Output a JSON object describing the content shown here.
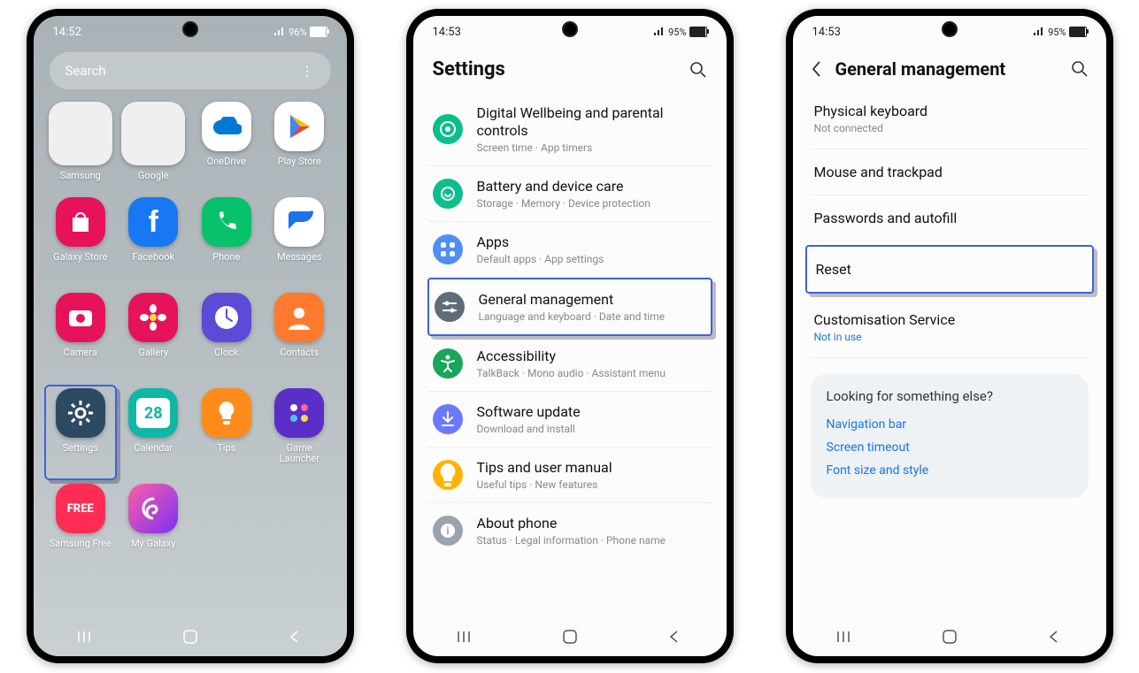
{
  "phone1": {
    "time": "14:52",
    "battery_text": "96%",
    "battery_level": 96,
    "search_placeholder": "Search",
    "apps": [
      {
        "label": "Samsung",
        "type": "folder",
        "colors": [
          "#0b62d6",
          "#00a3e0",
          "#ff9800",
          "#fff"
        ]
      },
      {
        "label": "Google",
        "type": "folder",
        "colors": [
          "#ea4335",
          "#4285f4",
          "#fbbc05",
          "#34a853"
        ]
      },
      {
        "label": "OneDrive",
        "bg": "#ffffff",
        "fg": "#0078d4",
        "glyph": "cloud"
      },
      {
        "label": "Play Store",
        "bg": "#ffffff",
        "fg": "#34a853",
        "glyph": "play"
      },
      {
        "label": "Galaxy Store",
        "bg": "#e6135a",
        "glyph": "bag"
      },
      {
        "label": "Facebook",
        "bg": "#1877f2",
        "glyph": "f"
      },
      {
        "label": "Phone",
        "bg": "#08c26b",
        "glyph": "phone"
      },
      {
        "label": "Messages",
        "bg": "#ffffff",
        "fg": "#1a73e8",
        "glyph": "chat"
      },
      {
        "label": "Camera",
        "bg": "#e6135a",
        "glyph": "camera"
      },
      {
        "label": "Gallery",
        "bg": "#e6135a",
        "glyph": "flower"
      },
      {
        "label": "Clock",
        "bg": "#5b4bd6",
        "glyph": "clock"
      },
      {
        "label": "Contacts",
        "bg": "#ff7a2f",
        "glyph": "person"
      },
      {
        "label": "Settings",
        "bg": "#2d4a63",
        "glyph": "gear",
        "highlight": true
      },
      {
        "label": "Calendar",
        "bg": "#0fb7a7",
        "glyph": "28"
      },
      {
        "label": "Tips",
        "bg": "#ff8c1a",
        "glyph": "bulb"
      },
      {
        "label": "Game Launcher",
        "bg": "#5b2ec7",
        "glyph": "dots4"
      },
      {
        "label": "Samsung Free",
        "bg": "#ff2d55",
        "glyph": "FREE"
      },
      {
        "label": "My Galaxy",
        "bg": "linear-gradient(135deg,#ff5fa2,#7b2ff7)",
        "glyph": "swirl"
      }
    ]
  },
  "phone2": {
    "time": "14:53",
    "battery_text": "95%",
    "title": "Settings",
    "rows": [
      {
        "title": "Digital Wellbeing and parental controls",
        "sub": "Screen time  ·  App timers",
        "color": "#0abf8c",
        "glyph": "target"
      },
      {
        "title": "Battery and device care",
        "sub": "Storage  ·  Memory  ·  Device protection",
        "color": "#0abf8c",
        "glyph": "care"
      },
      {
        "title": "Apps",
        "sub": "Default apps  ·  App settings",
        "color": "#4f8ef7",
        "glyph": "grid4"
      },
      {
        "title": "General management",
        "sub": "Language and keyboard  ·  Date and time",
        "color": "#5f6c7b",
        "glyph": "sliders",
        "highlight": true
      },
      {
        "title": "Accessibility",
        "sub": "TalkBack  ·  Mono audio  ·  Assistant menu",
        "color": "#17a65a",
        "glyph": "a11y"
      },
      {
        "title": "Software update",
        "sub": "Download and install",
        "color": "#6b79ff",
        "glyph": "download"
      },
      {
        "title": "Tips and user manual",
        "sub": "Useful tips  ·  New features",
        "color": "#ffb300",
        "glyph": "bulb"
      },
      {
        "title": "About phone",
        "sub": "Status  ·  Legal information  ·  Phone name",
        "color": "#9aa4ae",
        "glyph": "info"
      }
    ]
  },
  "phone3": {
    "time": "14:53",
    "battery_text": "95%",
    "title": "General management",
    "rows": [
      {
        "title": "Physical keyboard",
        "sub": "Not connected"
      },
      {
        "title": "Mouse and trackpad"
      },
      {
        "title": "Passwords and autofill"
      },
      {
        "title": "Reset",
        "highlight": true
      },
      {
        "title": "Customisation Service",
        "sub": "Not in use",
        "sub_blue": true
      }
    ],
    "suggest_title": "Looking for something else?",
    "suggest_links": [
      "Navigation bar",
      "Screen timeout",
      "Font size and style"
    ]
  }
}
